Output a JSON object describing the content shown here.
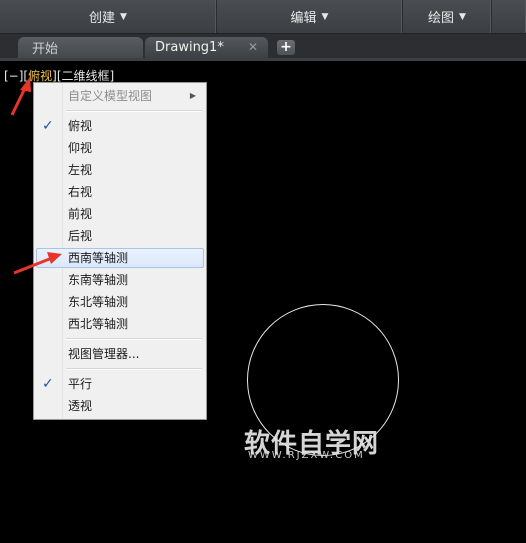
{
  "ribbon": {
    "panels": [
      {
        "label": "创建"
      },
      {
        "label": "编辑"
      },
      {
        "label": "绘图"
      }
    ]
  },
  "tabs": {
    "start_label": "开始",
    "drawing_label": "Drawing1*",
    "close_glyph": "✕",
    "add_glyph": "+"
  },
  "viewport": {
    "minus": "[−]",
    "view": "俯视",
    "style": "[二维线框]"
  },
  "menu": {
    "custom_views": "自定义模型视图",
    "views": [
      "俯视",
      "仰视",
      "左视",
      "右视",
      "前视",
      "后视",
      "西南等轴测",
      "东南等轴测",
      "东北等轴测",
      "西北等轴测"
    ],
    "view_manager": "视图管理器...",
    "projection": [
      "平行",
      "透视"
    ],
    "checked_view": "俯视",
    "highlighted_view": "西南等轴测",
    "checked_projection": "平行"
  },
  "watermark": {
    "cn": "软件自学网",
    "en": "WWW.RJZXW.COM"
  },
  "colors": {
    "accent_label": "#f5c542",
    "arrow": "#e8352b",
    "check": "#1f55a8"
  }
}
